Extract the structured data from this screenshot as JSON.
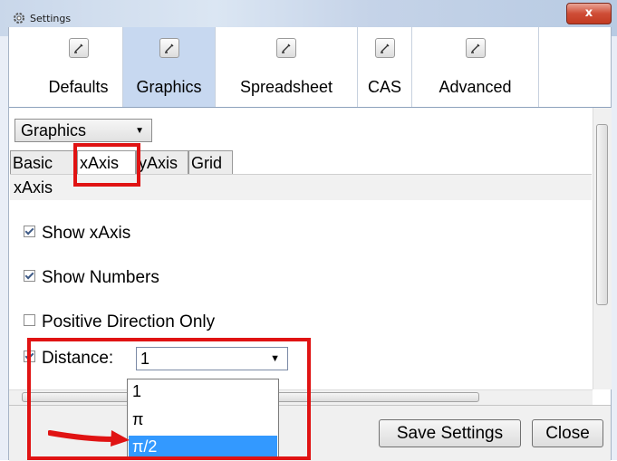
{
  "window": {
    "title": "Settings",
    "close_label": "x"
  },
  "main_tabs": [
    {
      "label": "Defaults",
      "icon": "wrench-icon",
      "active": false
    },
    {
      "label": "Graphics",
      "icon": "wrench-icon",
      "active": true
    },
    {
      "label": "Spreadsheet",
      "icon": "wrench-icon",
      "active": false
    },
    {
      "label": "CAS",
      "icon": "wrench-icon",
      "active": false
    },
    {
      "label": "Advanced",
      "icon": "wrench-icon",
      "active": false
    }
  ],
  "view_select": {
    "value": "Graphics"
  },
  "sub_tabs": [
    {
      "label": "Basic",
      "active": false
    },
    {
      "label": "xAxis",
      "active": true
    },
    {
      "label": "yAxis",
      "active": false
    },
    {
      "label": "Grid",
      "active": false
    }
  ],
  "section": {
    "title": "xAxis"
  },
  "options": {
    "show_axis": {
      "label": "Show xAxis",
      "checked": true
    },
    "show_numbers": {
      "label": "Show Numbers",
      "checked": true
    },
    "positive_only": {
      "label": "Positive Direction Only",
      "checked": false
    },
    "distance": {
      "label": "Distance:",
      "checked": true,
      "value": "1",
      "options": [
        "1",
        "π",
        "π/2"
      ],
      "highlighted": "π/2"
    }
  },
  "footer": {
    "save_label": "Save Settings",
    "close_label": "Close"
  },
  "colors": {
    "annotation": "#e01313",
    "selection": "#3399ff",
    "active_tab": "#c7d8f0"
  }
}
